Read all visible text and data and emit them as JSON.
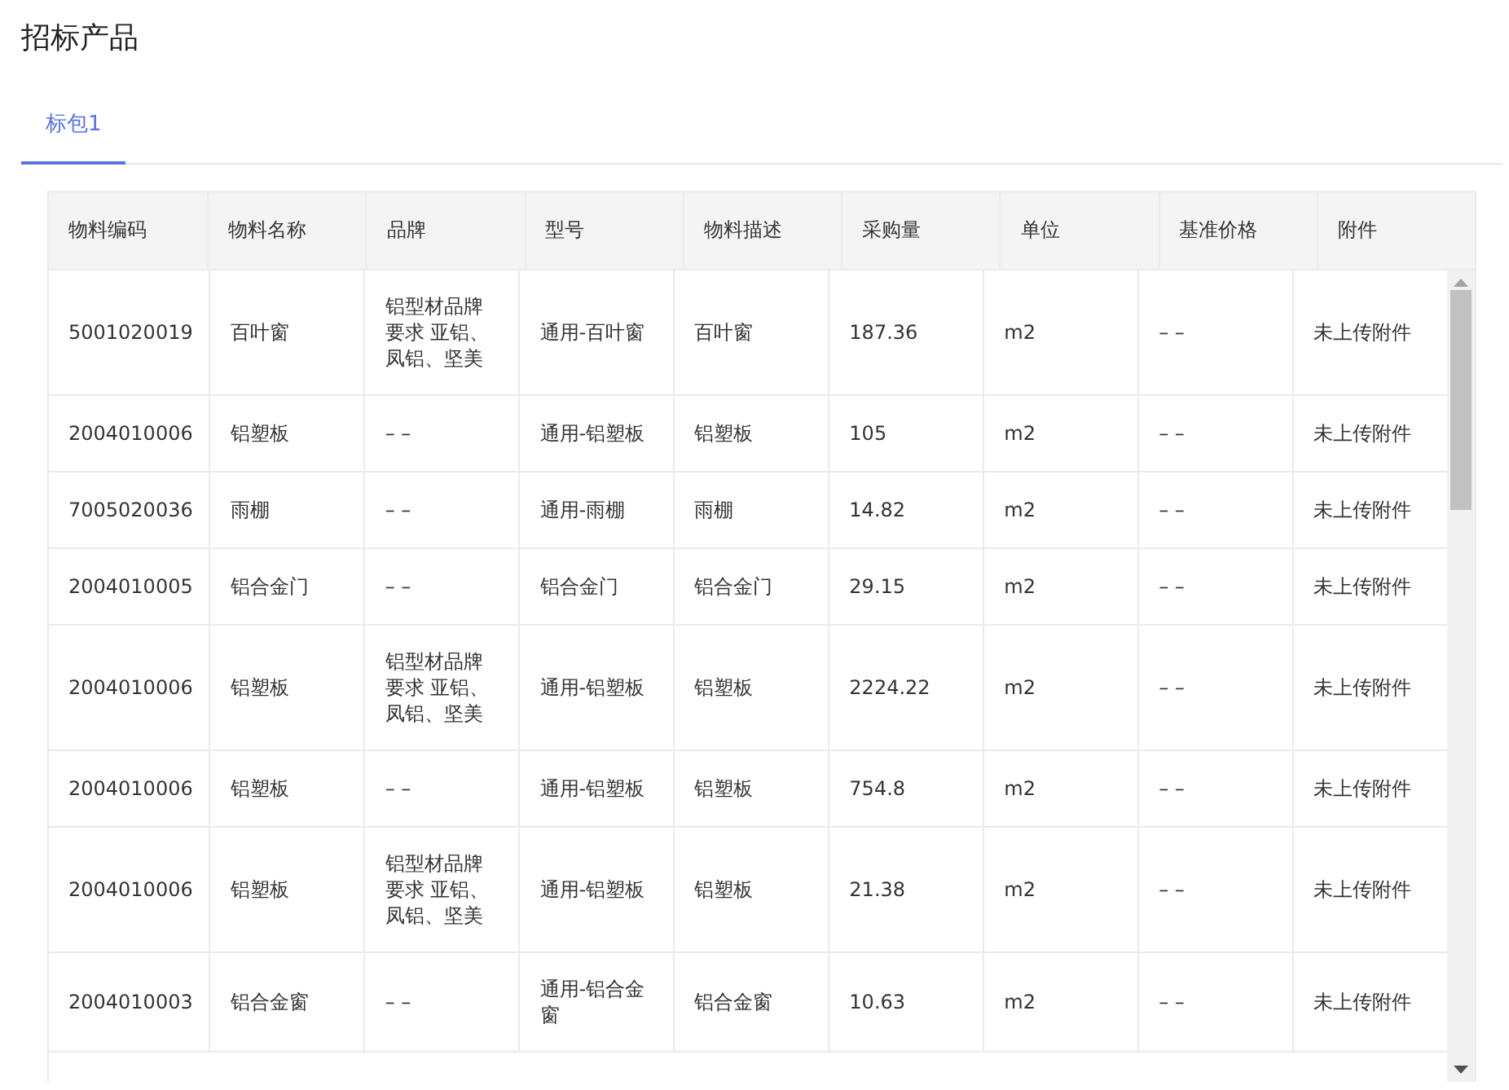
{
  "page": {
    "title": "招标产品"
  },
  "tabs": [
    {
      "label": "标包1",
      "selected": true
    }
  ],
  "table": {
    "columns": [
      "物料编码",
      "物料名称",
      "品牌",
      "型号",
      "物料描述",
      "采购量",
      "单位",
      "基准价格",
      "附件"
    ],
    "rows": [
      {
        "cells": [
          "5001020019",
          "百叶窗",
          "铝型材品牌要求 亚铝、凤铝、坚美",
          "通用-百叶窗",
          "百叶窗",
          "187.36",
          "m2",
          "– –",
          "未上传附件"
        ]
      },
      {
        "cells": [
          "2004010006",
          "铝塑板",
          "– –",
          "通用-铝塑板",
          "铝塑板",
          "105",
          "m2",
          "– –",
          "未上传附件"
        ]
      },
      {
        "cells": [
          "7005020036",
          "雨棚",
          "– –",
          "通用-雨棚",
          "雨棚",
          "14.82",
          "m2",
          "– –",
          "未上传附件"
        ]
      },
      {
        "cells": [
          "2004010005",
          "铝合金门",
          "– –",
          "铝合金门",
          "铝合金门",
          "29.15",
          "m2",
          "– –",
          "未上传附件"
        ]
      },
      {
        "cells": [
          "2004010006",
          "铝塑板",
          "铝型材品牌要求 亚铝、凤铝、坚美",
          "通用-铝塑板",
          "铝塑板",
          "2224.22",
          "m2",
          "– –",
          "未上传附件"
        ]
      },
      {
        "cells": [
          "2004010006",
          "铝塑板",
          "– –",
          "通用-铝塑板",
          "铝塑板",
          "754.8",
          "m2",
          "– –",
          "未上传附件"
        ]
      },
      {
        "cells": [
          "2004010006",
          "铝塑板",
          "铝型材品牌要求 亚铝、凤铝、坚美",
          "通用-铝塑板",
          "铝塑板",
          "21.38",
          "m2",
          "– –",
          "未上传附件"
        ]
      },
      {
        "cells": [
          "2004010003",
          "铝合金窗",
          "– –",
          "通用-铝合金窗",
          "铝合金窗",
          "10.63",
          "m2",
          "– –",
          "未上传附件"
        ]
      }
    ]
  }
}
